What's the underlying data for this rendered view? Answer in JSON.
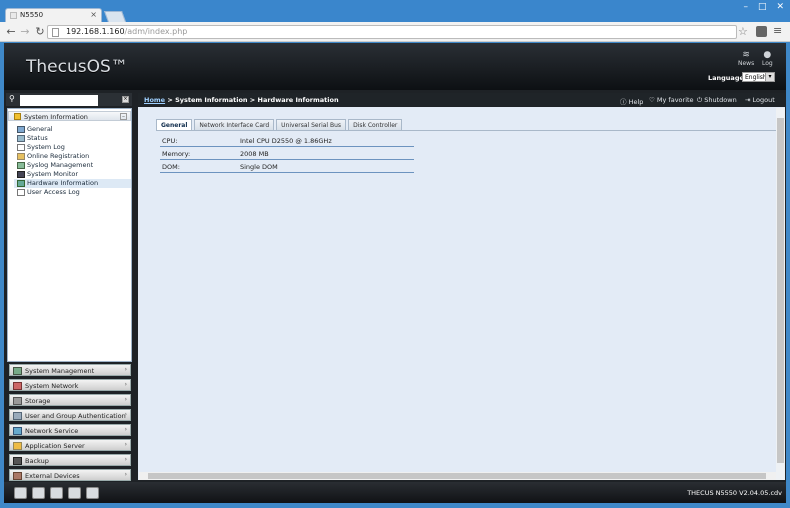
{
  "browser": {
    "tab_title": "N5550",
    "url_host": "192.168.1.160",
    "url_path": "/adm/index.php"
  },
  "header": {
    "logo": "ThecusOS™",
    "news_label": "News",
    "log_label": "Log",
    "language_label": "Language:",
    "language_value": "English"
  },
  "sidebar": {
    "search_placeholder": "",
    "group_title": "System Information",
    "items": [
      {
        "label": "General",
        "icon": "general-icon"
      },
      {
        "label": "Status",
        "icon": "status-icon"
      },
      {
        "label": "System Log",
        "icon": "system-log-icon"
      },
      {
        "label": "Online Registration",
        "icon": "registration-icon"
      },
      {
        "label": "Syslog Management",
        "icon": "syslog-icon"
      },
      {
        "label": "System Monitor",
        "icon": "monitor-icon"
      },
      {
        "label": "Hardware Information",
        "icon": "hardware-icon",
        "selected": true
      },
      {
        "label": "User Access Log",
        "icon": "access-log-icon"
      }
    ],
    "categories": [
      {
        "label": "System Management"
      },
      {
        "label": "System Network"
      },
      {
        "label": "Storage"
      },
      {
        "label": "User and Group Authentication"
      },
      {
        "label": "Network Service"
      },
      {
        "label": "Application Server"
      },
      {
        "label": "Backup"
      },
      {
        "label": "External Devices"
      }
    ]
  },
  "main": {
    "breadcrumb_home": "Home",
    "breadcrumb_rest": " > System Information > Hardware Information",
    "actions": {
      "help": "Help",
      "favorite": "My favorite",
      "shutdown": "Shutdown",
      "logout": "Logout"
    },
    "tabs": [
      {
        "label": "General",
        "active": true
      },
      {
        "label": "Network Interface Card"
      },
      {
        "label": "Universal Serial Bus"
      },
      {
        "label": "Disk Controller"
      }
    ],
    "info_rows": [
      {
        "key": "CPU:",
        "value": "Intel CPU D2550 @ 1.86GHz"
      },
      {
        "key": "Memory:",
        "value": "2008 MB"
      },
      {
        "key": "DOM:",
        "value": "Single DOM"
      }
    ]
  },
  "footer": {
    "version": "THECUS N5550 V2.04.05.cdv"
  },
  "colors": {
    "accent": "#3f88c8",
    "panel_bg": "#e3ebf6",
    "header_dark": "#1e2226"
  }
}
